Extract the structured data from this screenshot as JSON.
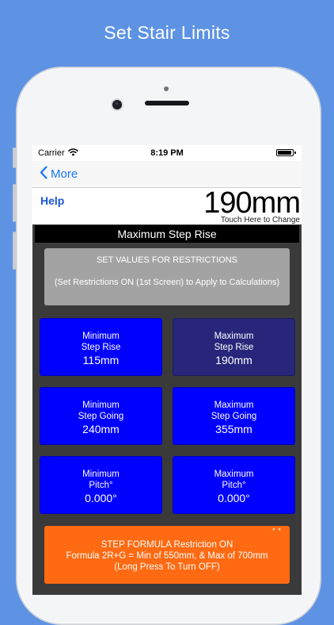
{
  "promo": {
    "title": "Set Stair Limits"
  },
  "status": {
    "carrier": "Carrier",
    "time": "8:19 PM"
  },
  "nav": {
    "back_label": "More"
  },
  "value_bar": {
    "help_label": "Help",
    "current_value": "190mm",
    "touch_hint": "Touch Here to Change"
  },
  "screen_title": "Maximum Step Rise",
  "set_values": {
    "line1": "SET VALUES FOR RESTRICTIONS",
    "line2": "(Set Restrictions ON (1st Screen) to Apply to Calculations)"
  },
  "tiles": [
    {
      "line1": "Minimum",
      "line2": "Step Rise",
      "value": "115mm",
      "color": "#0000ff"
    },
    {
      "line1": "Maximum",
      "line2": "Step Rise",
      "value": "190mm",
      "color": "#27267a"
    },
    {
      "line1": "Minimum",
      "line2": "Step Going",
      "value": "240mm",
      "color": "#0000ff"
    },
    {
      "line1": "Maximum",
      "line2": "Step Going",
      "value": "355mm",
      "color": "#0000ff"
    },
    {
      "line1": "Minimum",
      "line2": "Pitch°",
      "value": "0.000°",
      "color": "#0000ff"
    },
    {
      "line1": "Maximum",
      "line2": "Pitch°",
      "value": "0.000°",
      "color": "#0000ff"
    }
  ],
  "formula": {
    "line1": "STEP FORMULA Restriction ON",
    "line2": "Formula 2R+G = Min of 550mm, & Max of 700mm",
    "line3": "(Long Press To Turn OFF)",
    "color": "#ff6a12"
  },
  "icons": {
    "back": "chevron-left-icon",
    "wifi": "wifi-icon",
    "battery": "battery-icon"
  },
  "colors": {
    "background": "#5e93e4",
    "accent": "#1477f8"
  }
}
